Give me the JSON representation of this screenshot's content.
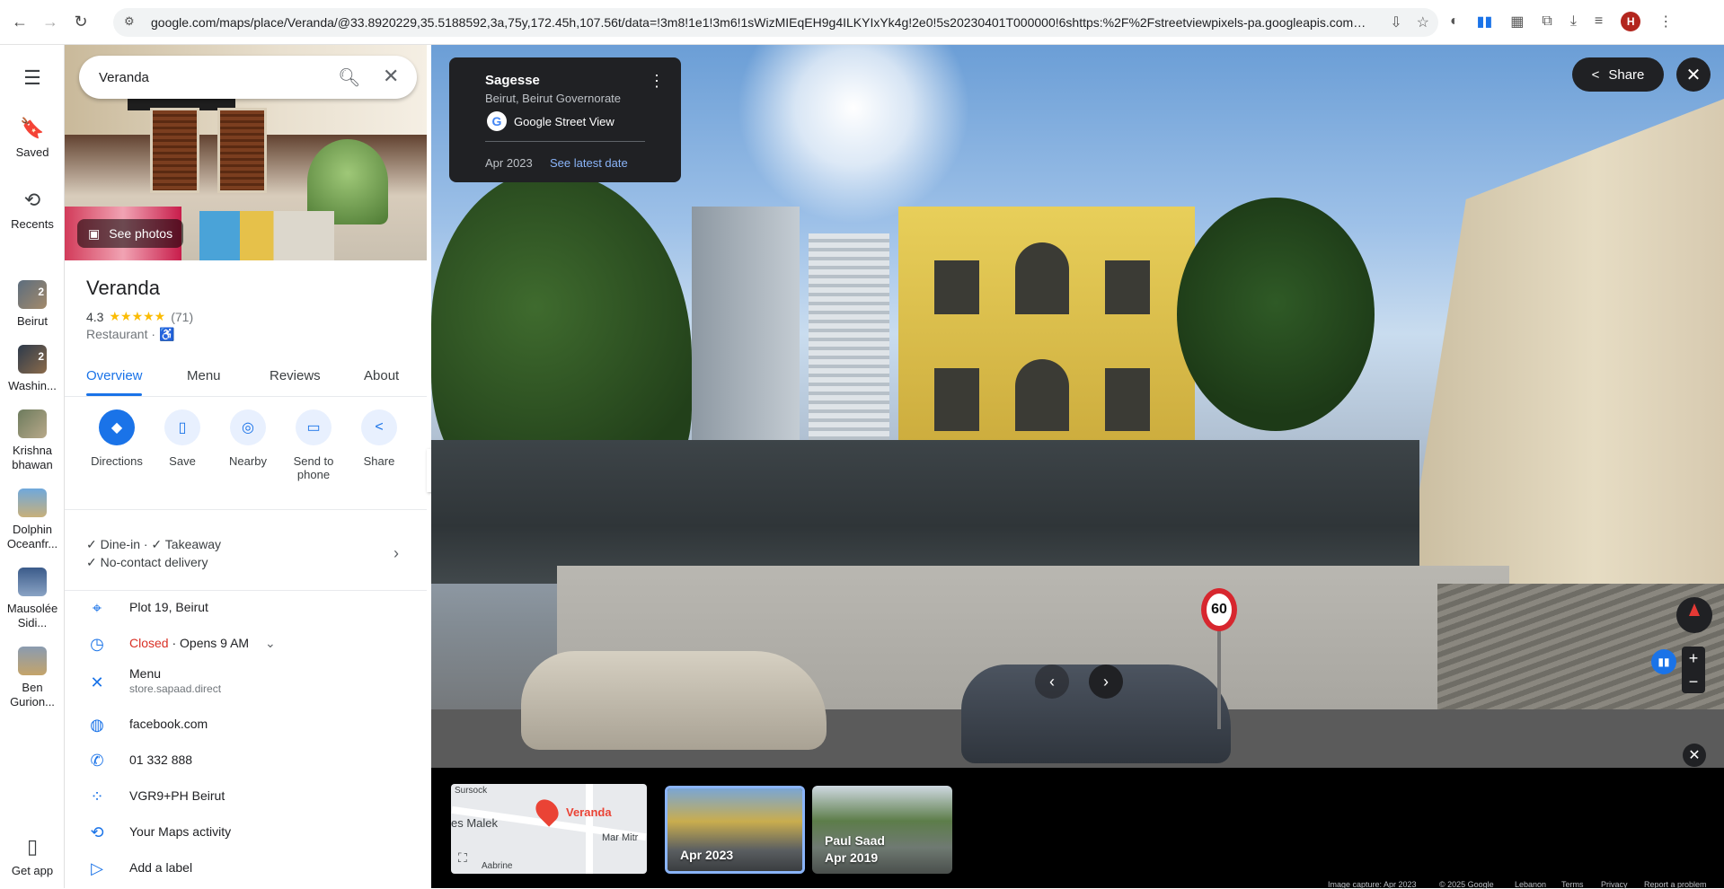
{
  "browser": {
    "url": "google.com/maps/place/Veranda/@33.8920229,35.5188592,3a,75y,172.45h,107.56t/data=!3m8!1e1!3m6!1sWizMIEqEH9g4ILKYIxYk4g!2e0!5s20230401T000000!6shttps:%2F%2Fstreetviewpixels-pa.googleapis.com%2Fv1%...",
    "profile_initial": "H"
  },
  "rail": {
    "saved": "Saved",
    "recents": "Recents",
    "places": [
      {
        "label": "Beirut",
        "badge": "2"
      },
      {
        "label": "Washin...",
        "badge": "2"
      },
      {
        "label": "Krishna bhawan"
      },
      {
        "label": "Dolphin Oceanfr..."
      },
      {
        "label": "Mausolée Sidi..."
      },
      {
        "label": "Ben Gurion..."
      }
    ],
    "get_app": "Get app"
  },
  "search": {
    "query": "Veranda"
  },
  "place": {
    "see_photos": "See photos",
    "name": "Veranda",
    "rating": "4.3",
    "stars": "★★★★★",
    "reviews_count": "(71)",
    "type": "Restaurant ·",
    "accessibility_icon": "♿",
    "tabs": [
      "Overview",
      "Menu",
      "Reviews",
      "About"
    ],
    "actions": [
      {
        "label": "Directions"
      },
      {
        "label": "Save"
      },
      {
        "label": "Nearby"
      },
      {
        "label": "Send to phone"
      },
      {
        "label": "Share"
      }
    ],
    "services_line1": "Dine-in · ✓ Takeaway",
    "services_line2": "No-contact delivery",
    "address": "Plot 19, Beirut",
    "hours_status": "Closed",
    "hours_next": " · Opens 9 AM",
    "menu_label": "Menu",
    "menu_link": "store.sapaad.direct",
    "website": "facebook.com",
    "phone": "01 332 888",
    "plus_code": "VGR9+PH Beirut",
    "maps_activity": "Your Maps activity",
    "add_label": "Add a label"
  },
  "streetview": {
    "card_title": "Sagesse",
    "card_subtitle": "Beirut, Beirut Governorate",
    "google_g": "G",
    "card_source": "Google Street View",
    "card_date": "Apr 2023",
    "card_latest": "See latest date",
    "share": "Share",
    "speed_sign": "60"
  },
  "filmstrip": {
    "map_label": "Veranda",
    "map_street1": "es Malek",
    "map_street2": "Mar Mitr",
    "map_top": "Sursock",
    "map_bottom": "Aabrine",
    "thumbs": [
      {
        "title": "",
        "date": "Apr 2023"
      },
      {
        "title": "Paul Saad",
        "date": "Apr 2019"
      }
    ]
  },
  "footer": {
    "capture": "Image capture: Apr 2023",
    "copyright": "© 2025 Google",
    "country": "Lebanon",
    "terms": "Terms",
    "privacy": "Privacy",
    "report": "Report a problem"
  }
}
